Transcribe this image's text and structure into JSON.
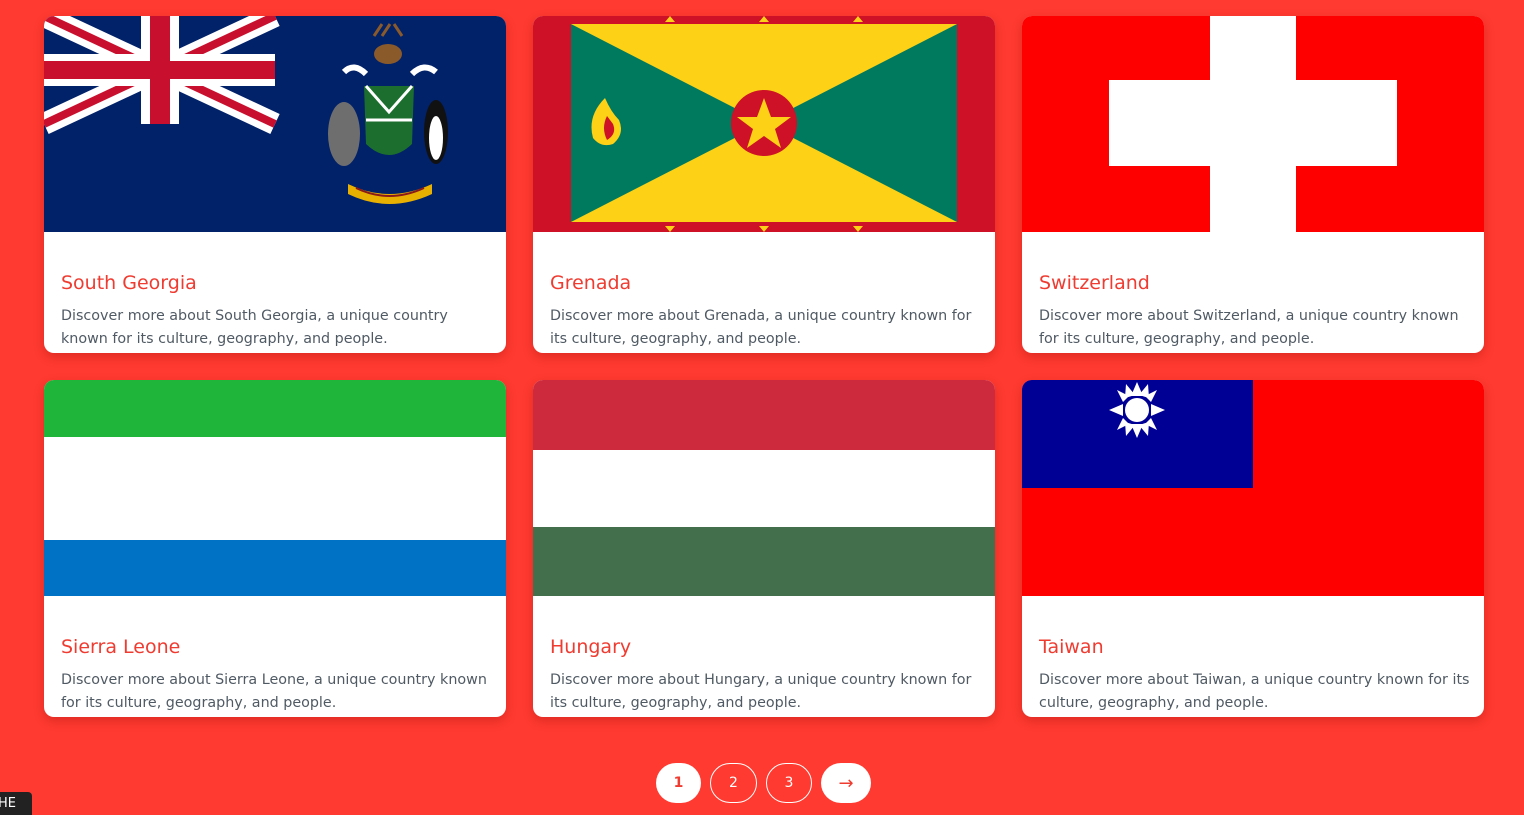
{
  "countries": [
    {
      "name": "South Georgia",
      "description": "Discover more about South Georgia, a unique country known for its culture, geography, and people.",
      "flag_icon": "south-georgia-flag"
    },
    {
      "name": "Grenada",
      "description": "Discover more about Grenada, a unique country known for its culture, geography, and people.",
      "flag_icon": "grenada-flag"
    },
    {
      "name": "Switzerland",
      "description": "Discover more about Switzerland, a unique country known for its culture, geography, and people.",
      "flag_icon": "switzerland-flag"
    },
    {
      "name": "Sierra Leone",
      "description": "Discover more about Sierra Leone, a unique country known for its culture, geography, and people.",
      "flag_icon": "sierra-leone-flag"
    },
    {
      "name": "Hungary",
      "description": "Discover more about Hungary, a unique country known for its culture, geography, and people.",
      "flag_icon": "hungary-flag"
    },
    {
      "name": "Taiwan",
      "description": "Discover more about Taiwan, a unique country known for its culture, geography, and people.",
      "flag_icon": "taiwan-flag"
    }
  ],
  "pagination": {
    "pages": [
      "1",
      "2",
      "3"
    ],
    "current": "1",
    "next_label": "→"
  },
  "corner_badge": "HE",
  "colors": {
    "background": "#ff3a30",
    "card": "#ffffff",
    "title": "#ef3b30",
    "description": "#505a64"
  }
}
